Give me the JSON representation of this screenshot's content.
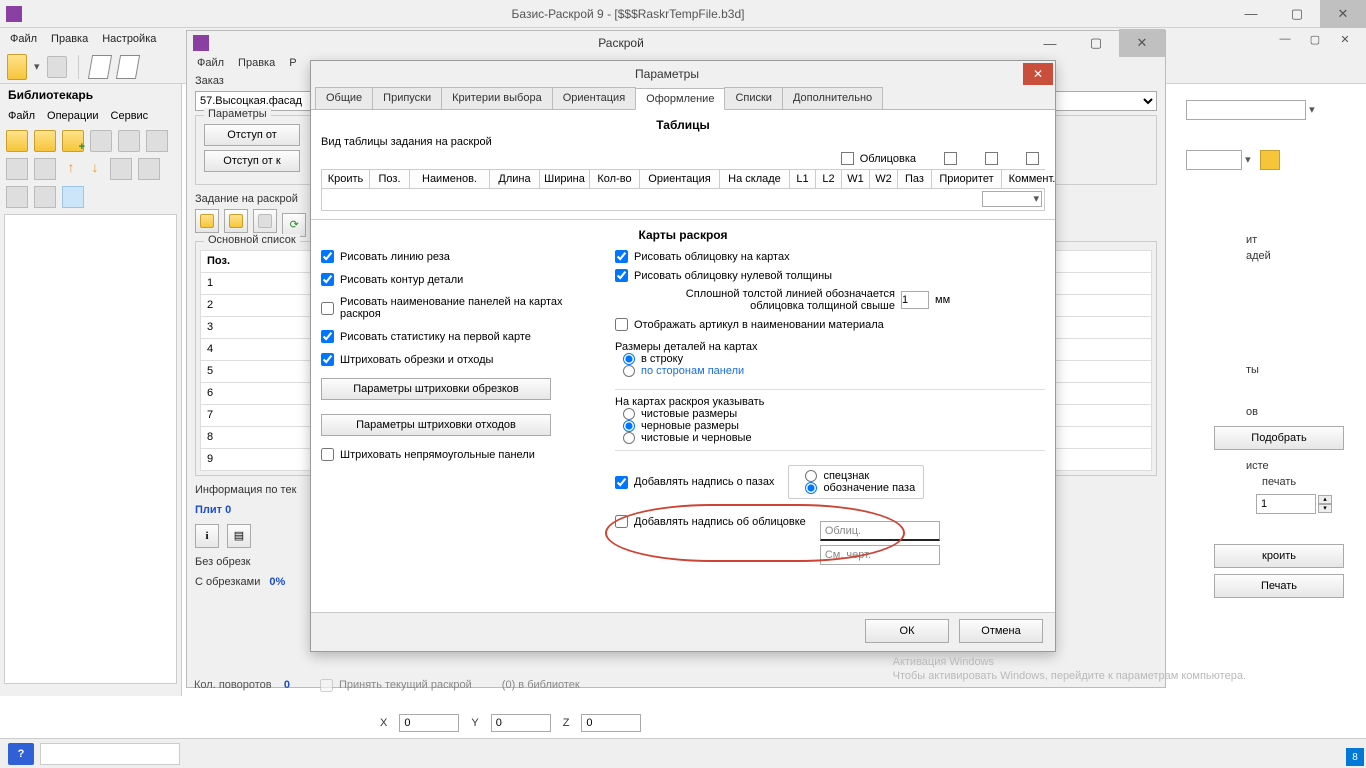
{
  "main": {
    "title": "Базис-Раскрой 9 - [$$$RaskrTempFile.b3d]",
    "menu": [
      "Файл",
      "Правка",
      "Настройка"
    ]
  },
  "lib": {
    "header": "Библиотекарь",
    "menu": [
      "Файл",
      "Операции",
      "Сервис"
    ]
  },
  "sub": {
    "title": "Раскрой",
    "menu": [
      "Файл",
      "Правка",
      "Р"
    ],
    "order_label": "Заказ",
    "order_value": "57.Высоцкая.фасад",
    "params_label": "Параметры",
    "btn_indent_1": "Отступ от",
    "btn_indent_2": "Отступ от к",
    "job_label": "Задание на раскрой",
    "main_list_label": "Основной список",
    "pos_head": "Поз.",
    "rows": [
      "1",
      "2",
      "3",
      "4",
      "5",
      "6",
      "7",
      "8",
      "9"
    ],
    "info_label": "Информация по тек",
    "slabs": "Плит  0",
    "no_scraps": "Без обрезк",
    "with_scraps": "С обрезками",
    "with_scraps_val": "0%",
    "turns_label": "Кол. поворотов",
    "turns_val": "0",
    "accept": "Принять текущий раскрой",
    "in_lib": "(0) в библиотек"
  },
  "right": {
    "word1": "ит",
    "word2": "адей",
    "word3": "ты",
    "word4": "ов",
    "pick": "Подобрать",
    "sheet": "исте",
    "print": "печать",
    "spin": "1",
    "cut": "кроить",
    "print2": "Печать"
  },
  "dlg": {
    "title": "Параметры",
    "tabs": [
      "Общие",
      "Припуски",
      "Критерии выбора",
      "Ориентация",
      "Оформление",
      "Списки",
      "Дополнительно"
    ],
    "tables": "Таблицы",
    "view_label": "Вид таблицы задания на раскрой",
    "facing": "Облицовка",
    "cols": [
      "Кроить",
      "Поз.",
      "Наименов.",
      "Длина",
      "Ширина",
      "Кол-во",
      "Ориентация",
      "На складе",
      "L1",
      "L2",
      "W1",
      "W2",
      "Паз",
      "Приоритет",
      "Коммент."
    ],
    "maps_header": "Карты раскроя",
    "left": {
      "cut_line": "Рисовать линию реза",
      "contour": "Рисовать контур детали",
      "names": "Рисовать наименование панелей на картах раскроя",
      "stats": "Рисовать статистику на первой карте",
      "hatch": "Штриховать обрезки и отходы",
      "hatch_btn1": "Параметры штриховки обрезков",
      "hatch_btn2": "Параметры штриховки отходов",
      "nonrect": "Штриховать непрямоугольные панели"
    },
    "right_col": {
      "facing_maps": "Рисовать облицовку на картах",
      "facing_zero": "Рисовать облицовку нулевой толщины",
      "thick_note": "Сплошной толстой линией обозначается облицовка толщиной свыше",
      "mm_val": "1",
      "mm": "мм",
      "article": "Отображать артикул в наименовании материала",
      "sizes_header": "Размеры деталей на картах",
      "size_row": "в строку",
      "size_sides": "по сторонам панели",
      "show_header": "На картах раскроя указывать",
      "clean": "чистовые размеры",
      "rough": "черновые размеры",
      "both": "чистовые и черновые",
      "paz_label": "Добавлять надпись о пазах",
      "paz_spec": "спецзнак",
      "paz_name": "обозначение паза",
      "facing_label_add": "Добавлять надпись об облицовке",
      "input1": "Облиц.",
      "input2": "См. черт."
    },
    "ok": "ОК",
    "cancel": "Отмена"
  },
  "coords": {
    "x_label": "X",
    "x": "0",
    "y_label": "Y",
    "y": "0",
    "z_label": "Z",
    "z": "0"
  },
  "watermark": {
    "title": "Активация Windows",
    "sub": "Чтобы активировать Windows, перейдите к параметрам компьютера."
  }
}
